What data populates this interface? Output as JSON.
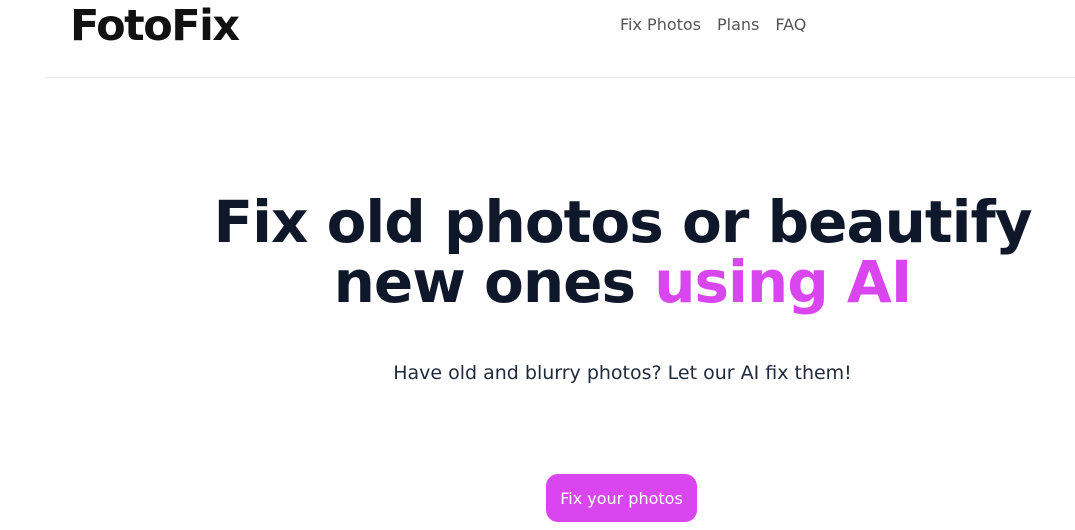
{
  "header": {
    "logo": "FotoFix",
    "nav": [
      {
        "label": "Fix Photos"
      },
      {
        "label": "Plans"
      },
      {
        "label": "FAQ"
      }
    ]
  },
  "hero": {
    "title_line1": "Fix old photos or beautify",
    "title_line2_plain": "new ones ",
    "title_line2_accent": "using AI",
    "subtitle": "Have old and blurry photos? Let our AI fix them!",
    "cta_label": "Fix your photos"
  },
  "colors": {
    "accent": "#d946ef",
    "heading": "#0f172a",
    "nav_text": "#555555",
    "divider": "#e5e7eb"
  }
}
